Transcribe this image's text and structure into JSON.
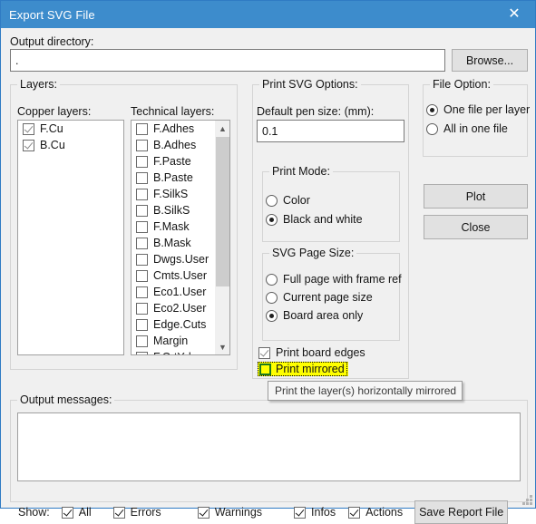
{
  "window": {
    "title": "Export SVG File",
    "close_icon": "close-icon"
  },
  "output_directory": {
    "label": "Output directory:",
    "value": ".",
    "browse_label": "Browse..."
  },
  "layers": {
    "group_title": "Layers:",
    "copper": {
      "label": "Copper layers:",
      "items": [
        {
          "label": "F.Cu",
          "checked": true
        },
        {
          "label": "B.Cu",
          "checked": true
        }
      ]
    },
    "technical": {
      "label": "Technical layers:",
      "items": [
        {
          "label": "F.Adhes",
          "checked": false
        },
        {
          "label": "B.Adhes",
          "checked": false
        },
        {
          "label": "F.Paste",
          "checked": false
        },
        {
          "label": "B.Paste",
          "checked": false
        },
        {
          "label": "F.SilkS",
          "checked": false
        },
        {
          "label": "B.SilkS",
          "checked": false
        },
        {
          "label": "F.Mask",
          "checked": false
        },
        {
          "label": "B.Mask",
          "checked": false
        },
        {
          "label": "Dwgs.User",
          "checked": false
        },
        {
          "label": "Cmts.User",
          "checked": false
        },
        {
          "label": "Eco1.User",
          "checked": false
        },
        {
          "label": "Eco2.User",
          "checked": false
        },
        {
          "label": "Edge.Cuts",
          "checked": false
        },
        {
          "label": "Margin",
          "checked": false
        },
        {
          "label": "F.CrtYd",
          "checked": false
        }
      ],
      "scroll_up_icon": "chevron-up-icon",
      "scroll_down_icon": "chevron-down-icon"
    }
  },
  "print_svg_options": {
    "group_title": "Print SVG Options:",
    "pen_size": {
      "label": "Default pen size: (mm):",
      "value": "0.1"
    },
    "print_mode": {
      "group_title": "Print Mode:",
      "options": [
        {
          "label": "Color",
          "selected": false
        },
        {
          "label": "Black and white",
          "selected": true
        }
      ]
    },
    "page_size": {
      "group_title": "SVG Page Size:",
      "options": [
        {
          "label": "Full page with  frame ref",
          "selected": false
        },
        {
          "label": "Current page size",
          "selected": false
        },
        {
          "label": "Board area only",
          "selected": true
        }
      ]
    },
    "print_board_edges": {
      "label": "Print board edges",
      "checked": true
    },
    "print_mirrored": {
      "label": "Print mirrored",
      "checked": false,
      "focused": true,
      "highlight_color": "#ffff00"
    }
  },
  "file_option": {
    "group_title": "File Option:",
    "options": [
      {
        "label": "One file per layer",
        "selected": true
      },
      {
        "label": "All in one file",
        "selected": false
      }
    ]
  },
  "actions": {
    "plot_label": "Plot",
    "close_label": "Close"
  },
  "tooltip": {
    "text": "Print the layer(s) horizontally mirrored"
  },
  "output_messages": {
    "group_title": "Output messages:",
    "content": "",
    "show_label": "Show:",
    "filters": [
      {
        "label": "All",
        "checked": true
      },
      {
        "label": "Errors",
        "checked": true
      },
      {
        "label": "Warnings",
        "checked": true
      },
      {
        "label": "Infos",
        "checked": true
      },
      {
        "label": "Actions",
        "checked": true
      }
    ],
    "save_report_label": "Save Report File"
  },
  "colors": {
    "titlebar": "#3d8ccc",
    "dialog_bg": "#f0f0f0",
    "highlight": "#ffff00",
    "focus_border": "#1e7a1e"
  }
}
